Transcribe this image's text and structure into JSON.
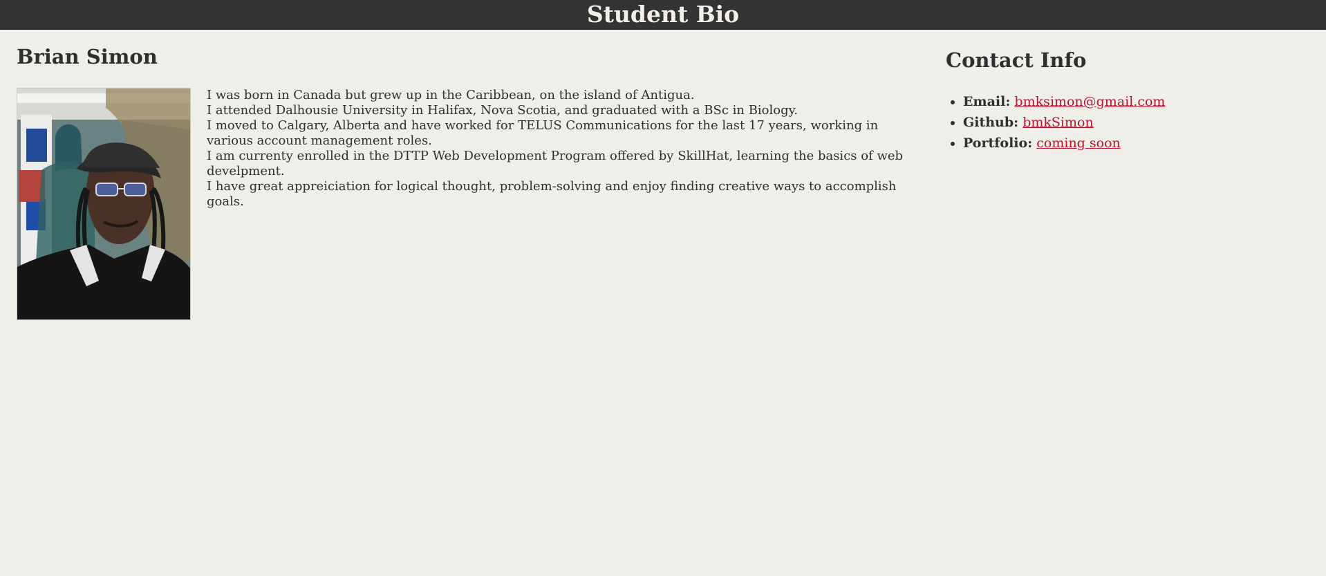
{
  "header": {
    "title": "Student Bio"
  },
  "profile": {
    "name": "Brian Simon",
    "photo_alt": "Brian Simon photo"
  },
  "bio": {
    "lines": [
      "I was born in Canada but grew up in the Caribbean, on the island of Antigua.",
      "I attended Dalhousie University in Halifax, Nova Scotia, and graduated with a BSc in Biology.",
      "I moved to Calgary, Alberta and have worked for TELUS Communications for the last 17 years, working in various account management roles.",
      "I am currenty enrolled in the DTTP Web Development Program offered by SkillHat, learning the basics of web develpment.",
      "I have great appreiciation for logical thought, problem-solving and enjoy finding creative ways to accomplish goals."
    ]
  },
  "contact": {
    "title": "Contact Info",
    "items": [
      {
        "label": "Email:",
        "link_text": "bmksimon@gmail.com"
      },
      {
        "label": "Github:",
        "link_text": "bmkSimon"
      },
      {
        "label": "Portfolio:",
        "link_text": "coming soon"
      }
    ]
  },
  "colors": {
    "page_background": "#efeee8",
    "header_background": "#333333",
    "text": "#2f2f2f",
    "link": "#b3142d"
  }
}
